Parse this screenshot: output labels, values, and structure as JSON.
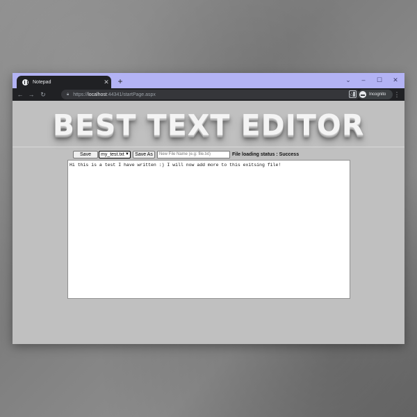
{
  "browser": {
    "tab": {
      "title": "Notepad",
      "close_glyph": "✕",
      "favicon": "globe-icon"
    },
    "new_tab_glyph": "+",
    "window_controls": {
      "menu": "⌄",
      "minimize": "–",
      "maximize": "☐",
      "close": "✕"
    },
    "nav": {
      "back": "←",
      "forward": "→",
      "reload": "↻"
    },
    "url": {
      "scheme": "https://",
      "host": "localhost",
      "path": ":44341/startPage.aspx"
    },
    "star_glyph": "☆",
    "incognito_label": "Incognito",
    "menu_glyph": "⋮",
    "tab_strip_color": "#b3b3f4",
    "toolbar_color": "#202124"
  },
  "page": {
    "background": "#c0c0c0",
    "banner_title": "BEST TEXT EDITOR",
    "controls": {
      "save_label": "Save",
      "file_select_value": "my_test.txt",
      "save_as_label": "Save As",
      "new_file_placeholder": "New File Name (e.g: file.txt)",
      "status_text": "File loading status : Success"
    },
    "editor_text": "Hi this is a test I have written :) I will now add more to this exitsing file!"
  }
}
